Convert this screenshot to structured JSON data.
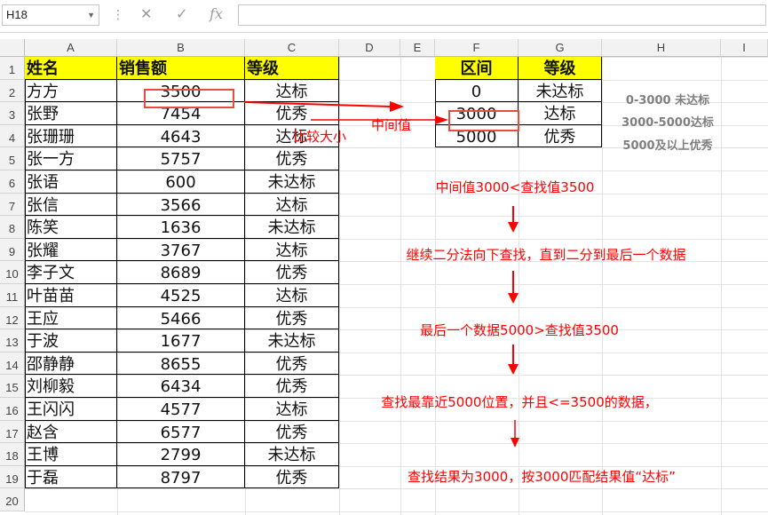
{
  "formula_bar": {
    "cell_ref": "H18",
    "formula": ""
  },
  "columns": [
    "A",
    "B",
    "C",
    "D",
    "E",
    "F",
    "G",
    "H",
    "I"
  ],
  "rows": [
    "1",
    "2",
    "3",
    "4",
    "5",
    "6",
    "7",
    "8",
    "9",
    "10",
    "11",
    "12",
    "13",
    "14",
    "15",
    "16",
    "17",
    "18",
    "19",
    "20"
  ],
  "main_table": {
    "headers": [
      "姓名",
      "销售额",
      "等级"
    ],
    "rows": [
      [
        "方方",
        "3500",
        "达标"
      ],
      [
        "张野",
        "7454",
        "优秀"
      ],
      [
        "张珊珊",
        "4643",
        "达标"
      ],
      [
        "张一方",
        "5757",
        "优秀"
      ],
      [
        "张语",
        "600",
        "未达标"
      ],
      [
        "张信",
        "3566",
        "达标"
      ],
      [
        "陈笑",
        "1636",
        "未达标"
      ],
      [
        "张耀",
        "3767",
        "达标"
      ],
      [
        "李子文",
        "8689",
        "优秀"
      ],
      [
        "叶苗苗",
        "4525",
        "达标"
      ],
      [
        "王应",
        "5466",
        "优秀"
      ],
      [
        "于波",
        "1677",
        "未达标"
      ],
      [
        "邵静静",
        "8655",
        "优秀"
      ],
      [
        "刘柳毅",
        "6434",
        "优秀"
      ],
      [
        "王闪闪",
        "4577",
        "达标"
      ],
      [
        "赵含",
        "6577",
        "优秀"
      ],
      [
        "王博",
        "2799",
        "未达标"
      ],
      [
        "于磊",
        "8797",
        "优秀"
      ]
    ]
  },
  "lookup_table": {
    "headers": [
      "区间",
      "等级"
    ],
    "rows": [
      [
        "0",
        "未达标"
      ],
      [
        "3000",
        "达标"
      ],
      [
        "5000",
        "优秀"
      ]
    ]
  },
  "legend": [
    "0-3000 未达标",
    "3000-5000达标",
    "5000及以上优秀"
  ],
  "annotations": {
    "middle_value": "中间值",
    "compare": "比较大小",
    "step1": "中间值3000<查找值3500",
    "step2": "继续二分法向下查找，直到二分到最后一个数据",
    "step3": "最后一个数据5000>查找值3500",
    "step4": "查找最靠近5000位置，并且<=3500的数据，",
    "step5": "查找结果为3000，按3000匹配结果值“达标”"
  },
  "colors": {
    "header_fill": "#ffff00",
    "annotation": "#ff0000",
    "highlight_box": "#e74c3c"
  }
}
